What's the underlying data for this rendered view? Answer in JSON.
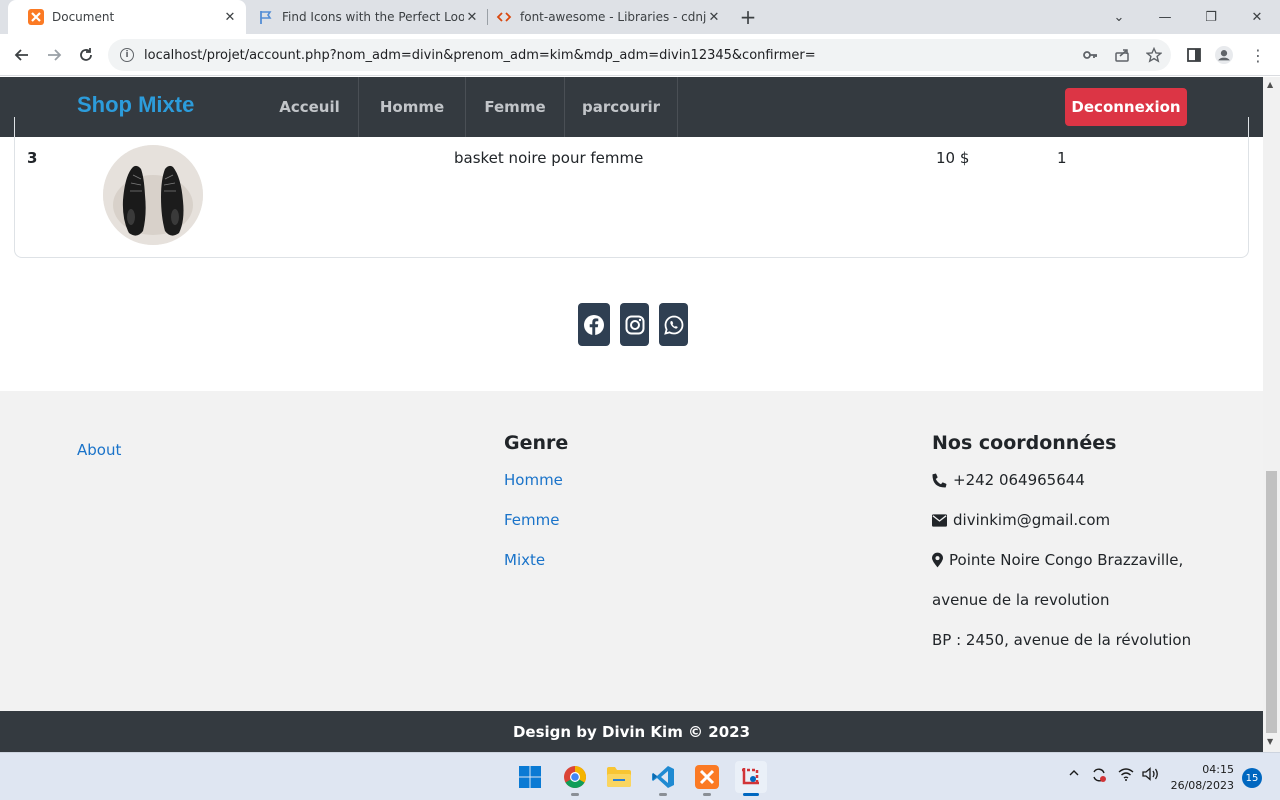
{
  "browser": {
    "tabs": [
      {
        "title": "Document",
        "active": true
      },
      {
        "title": "Find Icons with the Perfect Look",
        "active": false
      },
      {
        "title": "font-awesome - Libraries - cdnjs",
        "active": false
      }
    ],
    "url": "localhost/projet/account.php?nom_adm=divin&prenom_adm=kim&mdp_adm=divin12345&confirmer="
  },
  "site": {
    "brand": "Shop Mixte",
    "nav": [
      "Acceuil",
      "Homme",
      "Femme",
      "parcourir"
    ],
    "logout_label": "Deconnexion"
  },
  "order_row": {
    "number": "3",
    "description": "basket noire pour femme",
    "price": "10 $",
    "quantity": "1"
  },
  "social_icons": [
    "facebook-icon",
    "instagram-icon",
    "whatsapp-icon"
  ],
  "footer": {
    "about_label": "About",
    "genre": {
      "heading": "Genre",
      "links": [
        "Homme",
        "Femme",
        "Mixte"
      ]
    },
    "contact": {
      "heading": "Nos coordonnées",
      "phone": "+242 064965644",
      "email": "divinkim@gmail.com",
      "address_line1": "Pointe Noire Congo Brazzaville,",
      "address_line2": "avenue de la revolution",
      "po_box": "BP : 2450, avenue de la révolution"
    },
    "copyright": "Design by Divin Kim © 2023"
  },
  "taskbar": {
    "time": "04:15",
    "date": "26/08/2023",
    "notifications": "15"
  },
  "colors": {
    "brand": "#2c9cdb",
    "navbar": "#343a40",
    "danger": "#dc3545",
    "link": "#1a73c9",
    "social": "#2f3f52"
  }
}
